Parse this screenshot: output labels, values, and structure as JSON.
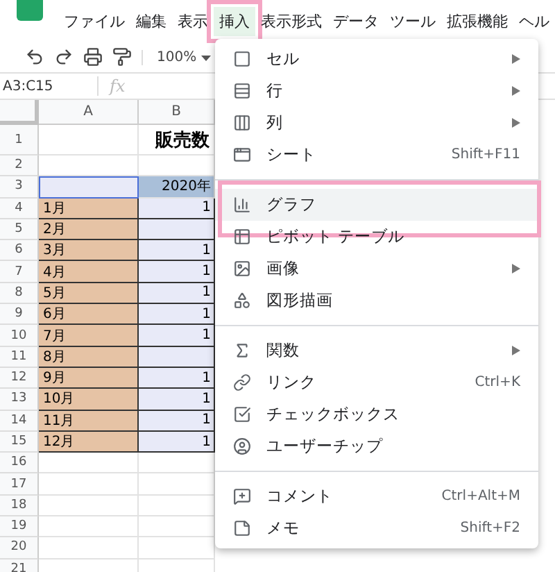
{
  "menubar": {
    "items": [
      {
        "label": "ファイル",
        "selected": false,
        "annotated": false
      },
      {
        "label": "編集",
        "selected": false,
        "annotated": false
      },
      {
        "label": "表示",
        "selected": false,
        "annotated": false
      },
      {
        "label": "挿入",
        "selected": true,
        "annotated": true
      },
      {
        "label": "表示形式",
        "selected": false,
        "annotated": false
      },
      {
        "label": "データ",
        "selected": false,
        "annotated": false
      },
      {
        "label": "ツール",
        "selected": false,
        "annotated": false
      },
      {
        "label": "拡張機能",
        "selected": false,
        "annotated": false
      },
      {
        "label": "ヘル",
        "selected": false,
        "annotated": false
      }
    ]
  },
  "toolbar": {
    "zoom": "100%"
  },
  "formula_bar": {
    "name_box": "A3:C15",
    "fx": "fx"
  },
  "columns": [
    "A",
    "B"
  ],
  "rows": [
    {
      "number": "1",
      "cells": [
        {
          "text": ""
        },
        {
          "text": "販売数",
          "kind": "title"
        }
      ]
    },
    {
      "number": "2",
      "cells": [
        {},
        {}
      ]
    },
    {
      "number": "3",
      "cells": [
        {
          "kind": "selected"
        },
        {
          "text": "2020年",
          "kind": "header"
        }
      ]
    },
    {
      "number": "4",
      "cells": [
        {
          "text": "1月",
          "kind": "month"
        },
        {
          "text": "1",
          "kind": "value"
        }
      ]
    },
    {
      "number": "5",
      "cells": [
        {
          "text": "2月",
          "kind": "month"
        },
        {
          "kind": "value"
        }
      ]
    },
    {
      "number": "6",
      "cells": [
        {
          "text": "3月",
          "kind": "month"
        },
        {
          "text": "1",
          "kind": "value"
        }
      ]
    },
    {
      "number": "7",
      "cells": [
        {
          "text": "4月",
          "kind": "month"
        },
        {
          "text": "1",
          "kind": "value"
        }
      ]
    },
    {
      "number": "8",
      "cells": [
        {
          "text": "5月",
          "kind": "month"
        },
        {
          "text": "1",
          "kind": "value"
        }
      ]
    },
    {
      "number": "9",
      "cells": [
        {
          "text": "6月",
          "kind": "month"
        },
        {
          "text": "1",
          "kind": "value"
        }
      ]
    },
    {
      "number": "10",
      "cells": [
        {
          "text": "7月",
          "kind": "month"
        },
        {
          "text": "1",
          "kind": "value"
        }
      ]
    },
    {
      "number": "11",
      "cells": [
        {
          "text": "8月",
          "kind": "month"
        },
        {
          "kind": "value"
        }
      ]
    },
    {
      "number": "12",
      "cells": [
        {
          "text": "9月",
          "kind": "month"
        },
        {
          "text": "1",
          "kind": "value"
        }
      ]
    },
    {
      "number": "13",
      "cells": [
        {
          "text": "10月",
          "kind": "month"
        },
        {
          "text": "1",
          "kind": "value"
        }
      ]
    },
    {
      "number": "14",
      "cells": [
        {
          "text": "11月",
          "kind": "month"
        },
        {
          "text": "1",
          "kind": "value"
        }
      ]
    },
    {
      "number": "15",
      "cells": [
        {
          "text": "12月",
          "kind": "month"
        },
        {
          "text": "1",
          "kind": "value"
        }
      ]
    },
    {
      "number": "16",
      "cells": [
        {},
        {}
      ]
    },
    {
      "number": "17",
      "cells": [
        {},
        {}
      ]
    },
    {
      "number": "18",
      "cells": [
        {},
        {}
      ]
    },
    {
      "number": "19",
      "cells": [
        {},
        {}
      ]
    },
    {
      "number": "20",
      "cells": [
        {},
        {}
      ]
    },
    {
      "number": "21",
      "cells": [
        {},
        {}
      ]
    }
  ],
  "menu": {
    "items": [
      {
        "kind": "item",
        "label": "セル",
        "submenu": true,
        "highlighted": false,
        "annotated": false
      },
      {
        "kind": "item",
        "label": "行",
        "submenu": true,
        "highlighted": false,
        "annotated": false
      },
      {
        "kind": "item",
        "label": "列",
        "submenu": true,
        "highlighted": false,
        "annotated": false
      },
      {
        "kind": "item",
        "label": "シート",
        "shortcut": "Shift+F11",
        "submenu": false,
        "highlighted": false,
        "annotated": false
      },
      {
        "kind": "separator"
      },
      {
        "kind": "item",
        "label": "グラフ",
        "submenu": false,
        "highlighted": true,
        "annotated": true
      },
      {
        "kind": "item",
        "label": "ピボット テーブル",
        "submenu": false,
        "highlighted": false,
        "annotated": false
      },
      {
        "kind": "item",
        "label": "画像",
        "submenu": true,
        "highlighted": false,
        "annotated": false
      },
      {
        "kind": "item",
        "label": "図形描画",
        "submenu": false,
        "highlighted": false,
        "annotated": false
      },
      {
        "kind": "separator"
      },
      {
        "kind": "item",
        "label": "関数",
        "submenu": true,
        "highlighted": false,
        "annotated": false
      },
      {
        "kind": "item",
        "label": "リンク",
        "shortcut": "Ctrl+K",
        "submenu": false,
        "highlighted": false,
        "annotated": false
      },
      {
        "kind": "item",
        "label": "チェックボックス",
        "submenu": false,
        "highlighted": false,
        "annotated": false
      },
      {
        "kind": "item",
        "label": "ユーザーチップ",
        "submenu": false,
        "highlighted": false,
        "annotated": false
      },
      {
        "kind": "separator"
      },
      {
        "kind": "item",
        "label": "コメント",
        "shortcut": "Ctrl+Alt+M",
        "submenu": false,
        "highlighted": false,
        "annotated": false
      },
      {
        "kind": "item",
        "label": "メモ",
        "shortcut": "Shift+F2",
        "submenu": false,
        "highlighted": false,
        "annotated": false
      }
    ]
  }
}
